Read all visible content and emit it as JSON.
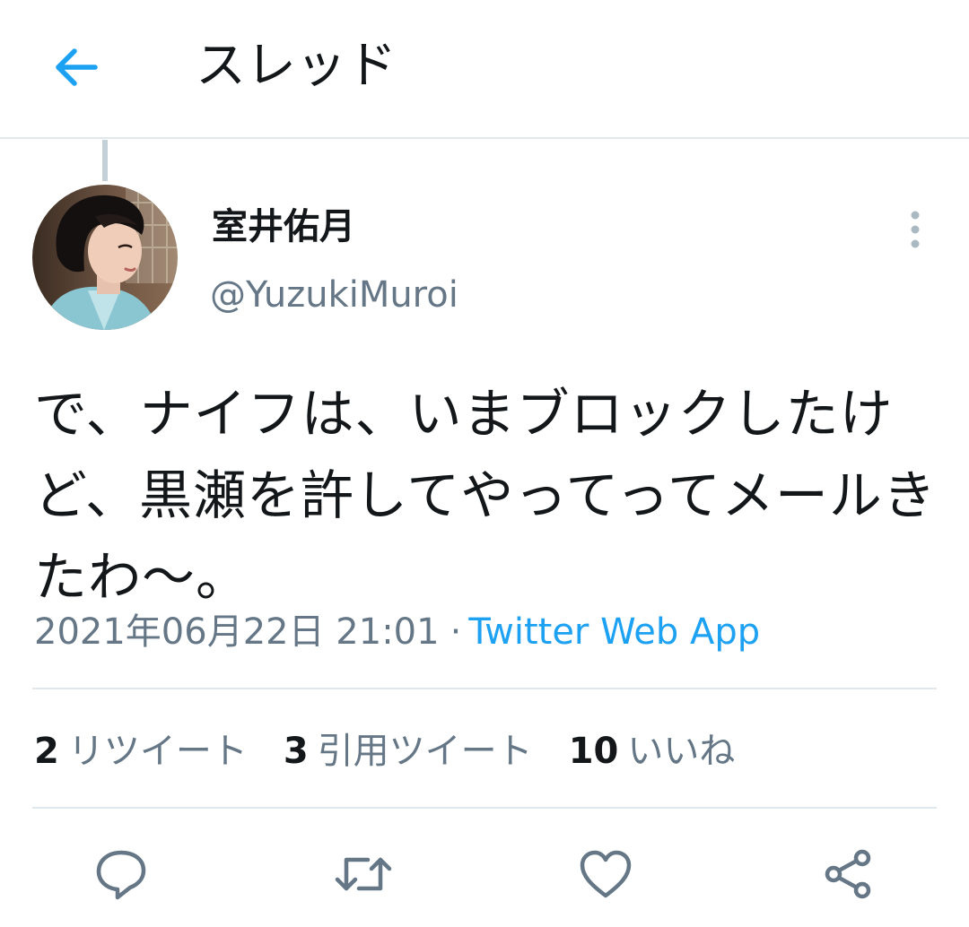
{
  "header": {
    "title": "スレッド",
    "back_icon": "arrow-left-icon"
  },
  "tweet": {
    "author": {
      "display_name": "室井佑月",
      "handle": "@YuzukiMuroi"
    },
    "text": "で、ナイフは、いまブロックしたけど、黒瀬を許してやってってメールきたわ〜。",
    "timestamp": "2021年06月22日 21:01",
    "separator": "·",
    "source": "Twitter Web App",
    "stats": {
      "retweets": {
        "count": "2",
        "label": "リツイート"
      },
      "quotes": {
        "count": "3",
        "label": "引用ツイート"
      },
      "likes": {
        "count": "10",
        "label": "いいね"
      }
    }
  },
  "actions": [
    "reply-icon",
    "retweet-icon",
    "like-icon",
    "share-icon"
  ],
  "colors": {
    "accent": "#1da1f2",
    "text_primary": "#14171a",
    "text_secondary": "#657786",
    "divider": "#e1e8ed"
  }
}
